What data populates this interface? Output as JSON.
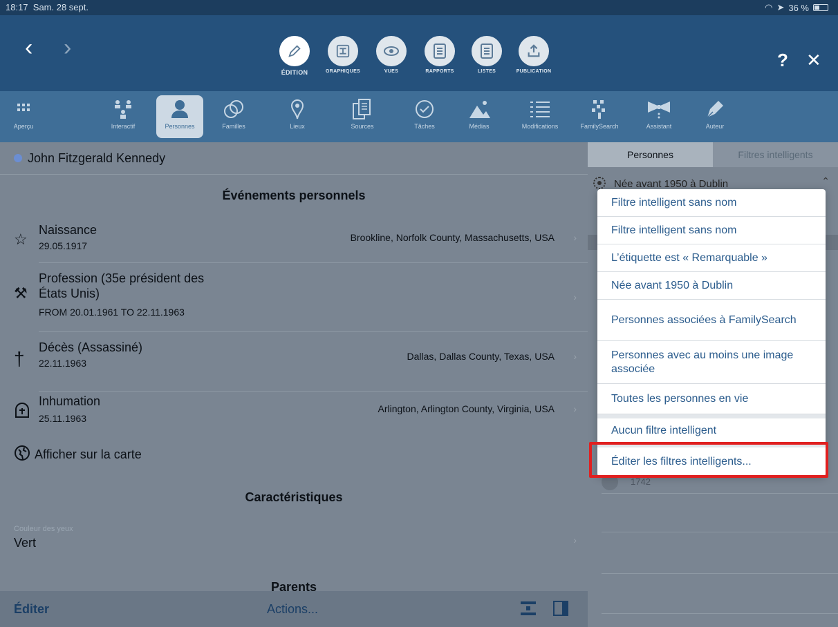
{
  "status": {
    "time": "18:17",
    "date": "Sam. 28 sept.",
    "battery": "36 %"
  },
  "modes": [
    {
      "label": "ÉDITION",
      "icon": "pencil-icon",
      "active": true
    },
    {
      "label": "GRAPHIQUES",
      "icon": "chart-icon"
    },
    {
      "label": "VUES",
      "icon": "eye-icon"
    },
    {
      "label": "RAPPORTS",
      "icon": "report-icon"
    },
    {
      "label": "LISTES",
      "icon": "list-icon"
    },
    {
      "label": "PUBLICATION",
      "icon": "upload-icon"
    }
  ],
  "top": {
    "help": "?",
    "close": "✕"
  },
  "tools": [
    {
      "label": "Aperçu",
      "icon": "grid-icon"
    },
    {
      "label": "Interactif",
      "icon": "tree-icon"
    },
    {
      "label": "Personnes",
      "icon": "person-icon",
      "active": true
    },
    {
      "label": "Familles",
      "icon": "rings-icon"
    },
    {
      "label": "Lieux",
      "icon": "pin-icon"
    },
    {
      "label": "Sources",
      "icon": "documents-icon"
    },
    {
      "label": "Tâches",
      "icon": "check-icon"
    },
    {
      "label": "Médias",
      "icon": "mountain-icon"
    },
    {
      "label": "Modifications",
      "icon": "list-lines-icon"
    },
    {
      "label": "FamilySearch",
      "icon": "familysearch-icon"
    },
    {
      "label": "Assistant",
      "icon": "bow-icon"
    },
    {
      "label": "Auteur",
      "icon": "pen-icon"
    }
  ],
  "person": {
    "name": "John Fitzgerald Kennedy"
  },
  "sections": {
    "events": "Événements personnels",
    "characteristics": "Caractéristiques",
    "parents": "Parents"
  },
  "events": [
    {
      "title": "Naissance",
      "date": "29.05.1917",
      "place": "Brookline, Norfolk County, Massachusetts, USA",
      "icon": "star-icon"
    },
    {
      "title": "Profession (35e président des",
      "title2": "États Unis)",
      "date": "FROM 20.01.1961 TO 22.11.1963",
      "place": "",
      "icon": "hammer-icon"
    },
    {
      "title": "Décès (Assassiné)",
      "date": "22.11.1963",
      "place": "Dallas, Dallas County, Texas, USA",
      "icon": "cross-icon"
    },
    {
      "title": "Inhumation",
      "date": "25.11.1963",
      "place": "Arlington, Arlington County, Virginia, USA",
      "icon": "tomb-icon"
    }
  ],
  "map_link": "Afficher sur la carte",
  "characteristic": {
    "label": "Couleur des yeux",
    "value": "Vert"
  },
  "bottom": {
    "edit": "Éditer",
    "actions": "Actions..."
  },
  "side": {
    "tabs": [
      "Personnes",
      "Filtres intelligents"
    ],
    "current_filter": "Née avant 1950 à Dublin",
    "partial_row": "1742"
  },
  "popup": {
    "items": [
      "Filtre intelligent sans nom",
      "Filtre intelligent sans nom",
      "L’étiquette est « Remarquable »",
      "Née avant 1950 à Dublin",
      "Personnes associées à FamilySearch",
      "Personnes avec au moins une image associée",
      "Toutes les personnes en vie",
      "Aucun filtre intelligent",
      "Éditer les filtres intelligents..."
    ]
  }
}
